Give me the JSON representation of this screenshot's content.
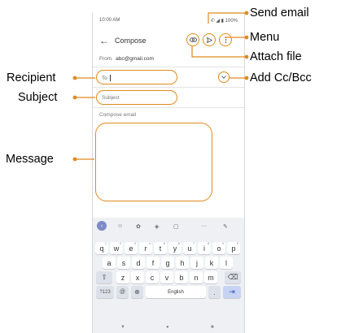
{
  "status_bar": {
    "time": "10:00 AM",
    "icons": "✆ ◢ ▮ 100%"
  },
  "app_bar": {
    "back_icon": "arrow-left-icon",
    "title": "Compose",
    "attach_icon": "link-icon",
    "send_icon": "send-icon",
    "menu_icon": "more-vert-icon"
  },
  "from": {
    "label": "From",
    "value": "abc@gmail.com"
  },
  "to": {
    "label": "To"
  },
  "subject": {
    "placeholder": "Subject"
  },
  "compose": {
    "placeholder": "Compose email"
  },
  "keyboard": {
    "toolbar": [
      "‹",
      "☺",
      "✿",
      "◈",
      "▢",
      "···",
      "✎"
    ],
    "row1": [
      "q",
      "w",
      "e",
      "r",
      "t",
      "y",
      "u",
      "i",
      "o",
      "p"
    ],
    "row1_hints": [
      "1",
      "2",
      "3",
      "4",
      "5",
      "6",
      "7",
      "8",
      "9",
      "0"
    ],
    "row2": [
      "a",
      "s",
      "d",
      "f",
      "g",
      "h",
      "j",
      "k",
      "l"
    ],
    "row3": [
      "z",
      "x",
      "c",
      "v",
      "b",
      "n",
      "m"
    ],
    "shift": "⇧",
    "backspace": "⌫",
    "symbols": "?123",
    "at": "@",
    "globe": "⊕",
    "space": "English",
    "period": ".",
    "enter": "⇥"
  },
  "nav_bar": {
    "back": "▼",
    "home": "●",
    "recents": "■"
  },
  "callouts": {
    "send_email": "Send email",
    "menu": "Menu",
    "attach_file": "Attach file",
    "recipient": "Recipient",
    "add_cc_bcc": "Add Cc/Bcc",
    "subject": "Subject",
    "message": "Message"
  },
  "colors": {
    "accent": "#e08a1e",
    "keyboard_bg": "#eef0f3",
    "enter_key": "#c7d3f2"
  }
}
